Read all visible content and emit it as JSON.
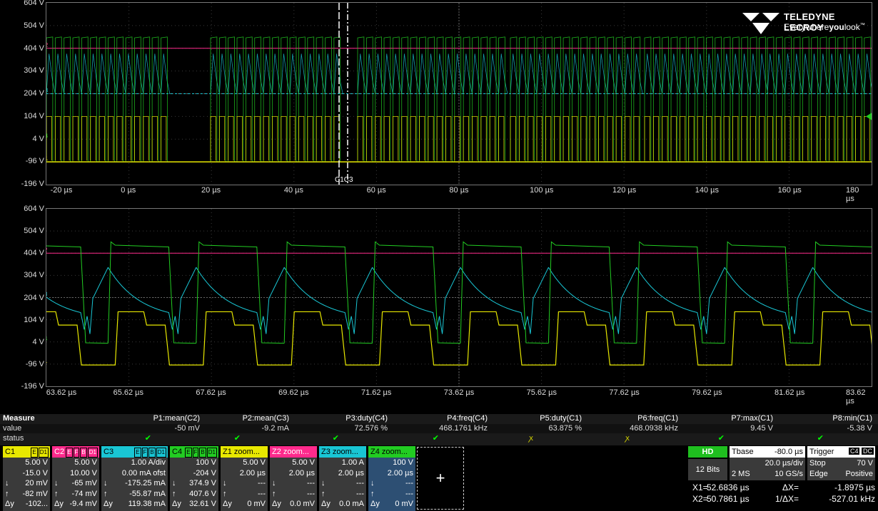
{
  "upper": {
    "y_labels": [
      "604 V",
      "504 V",
      "404 V",
      "304 V",
      "204 V",
      "104 V",
      "4 V",
      "-96 V",
      "-196 V"
    ],
    "x_labels": [
      "-20 µs",
      "0 µs",
      "20 µs",
      "40 µs",
      "60 µs",
      "80 µs",
      "100 µs",
      "120 µs",
      "140 µs",
      "160 µs",
      "180 µs"
    ],
    "cursor_label": "C1C3",
    "channel_tags": [
      "C2",
      "C3",
      "C4",
      "C1"
    ]
  },
  "lower": {
    "y_labels": [
      "604 V",
      "504 V",
      "404 V",
      "304 V",
      "204 V",
      "104 V",
      "4 V",
      "-96 V",
      "-196 V"
    ],
    "x_labels": [
      "63.62 µs",
      "65.62 µs",
      "67.62 µs",
      "69.62 µs",
      "71.62 µs",
      "73.62 µs",
      "75.62 µs",
      "77.62 µs",
      "79.62 µs",
      "81.62 µs",
      "83.62 µs"
    ],
    "channel_tags": [
      "Z2",
      "Z3",
      "Z4",
      "Z1"
    ]
  },
  "logo": {
    "name": "TELEDYNE LECROY",
    "tagline_a": "Everywhere",
    "tagline_b": "you",
    "tagline_c": "look",
    "tm": "™"
  },
  "measure": {
    "title": "Measure",
    "row_value": "value",
    "row_status": "status",
    "params": [
      {
        "name": "P1:mean(C2)",
        "value": "-50 mV",
        "status": "ok"
      },
      {
        "name": "P2:mean(C3)",
        "value": "-9.2 mA",
        "status": "ok"
      },
      {
        "name": "P3:duty(C4)",
        "value": "72.576 %",
        "status": "ok"
      },
      {
        "name": "P4:freq(C4)",
        "value": "468.1761 kHz",
        "status": "ok"
      },
      {
        "name": "P5:duty(C1)",
        "value": "63.875 %",
        "status": "warn"
      },
      {
        "name": "P6:freq(C1)",
        "value": "468.0938 kHz",
        "status": "warn"
      },
      {
        "name": "P7:max(C1)",
        "value": "9.45 V",
        "status": "ok"
      },
      {
        "name": "P8:min(C1)",
        "value": "-5.38 V",
        "status": "ok"
      }
    ],
    "ok_glyph": "✔",
    "warn_glyph": "ꭗ"
  },
  "channels": [
    {
      "name": "C1",
      "badges": [
        "E",
        "D1"
      ],
      "r1": "5.00 V",
      "r2": "-15.0 V",
      "r3a": "↓",
      "r3b": "20 mV",
      "r4a": "↑",
      "r4b": "-82 mV",
      "r5a": "Δy",
      "r5b": "-102..."
    },
    {
      "name": "C2",
      "badges": [
        "E",
        "F",
        "B",
        "D1"
      ],
      "r1": "5.00 V",
      "r2": "10.00 V",
      "r3a": "↓",
      "r3b": "-65 mV",
      "r4a": "↑",
      "r4b": "-74 mV",
      "r5a": "Δy",
      "r5b": "-9.4 mV"
    },
    {
      "name": "C3",
      "badges": [
        "E",
        "F",
        "B",
        "D1"
      ],
      "r1": "1.00 A/div",
      "r2": "0.00 mA ofst",
      "r3a": "↓",
      "r3b": "-175.25 mA",
      "r4a": "↑",
      "r4b": "-55.87 mA",
      "r5a": "Δy",
      "r5b": "119.38 mA"
    },
    {
      "name": "C4",
      "badges": [
        "E",
        "F",
        "B",
        "D1"
      ],
      "r1": "100 V",
      "r2": "-204 V",
      "r3a": "↓",
      "r3b": "374.9 V",
      "r4a": "↑",
      "r4b": "407.6 V",
      "r5a": "Δy",
      "r5b": "32.61 V"
    },
    {
      "name": "Z1 zoom...",
      "badges": [],
      "r1": "5.00 V",
      "r2": "2.00 µs",
      "r3a": "↓",
      "r3b": "---",
      "r4a": "↑",
      "r4b": "---",
      "r5a": "Δy",
      "r5b": "0 mV"
    },
    {
      "name": "Z2 zoom...",
      "badges": [],
      "r1": "5.00 V",
      "r2": "2.00 µs",
      "r3a": "↓",
      "r3b": "---",
      "r4a": "↑",
      "r4b": "---",
      "r5a": "Δy",
      "r5b": "0.0 mV"
    },
    {
      "name": "Z3 zoom...",
      "badges": [],
      "r1": "1.00 A",
      "r2": "2.00 µs",
      "r3a": "↓",
      "r3b": "---",
      "r4a": "↑",
      "r4b": "---",
      "r5a": "Δy",
      "r5b": "0.0 mA"
    },
    {
      "name": "Z4 zoom...",
      "badges": [],
      "r1": "100 V",
      "r2": "2.00 µs",
      "r3a": "↓",
      "r3b": "---",
      "r4a": "↑",
      "r4b": "---",
      "r5a": "Δy",
      "r5b": "0 mV"
    }
  ],
  "add_button": "+",
  "timebase": {
    "hd_label": "HD",
    "bits": "12 Bits",
    "tbase_label": "Tbase",
    "tbase_value": "-80.0 µs",
    "div": "20.0 µs/div",
    "samples": "2 MS",
    "rate": "10 GS/s",
    "trigger_label": "Trigger",
    "trig_badges": [
      "C4",
      "DC"
    ],
    "trig_mode": "Stop",
    "trig_level": "70 V",
    "trig_type": "Edge",
    "trig_slope": "Positive"
  },
  "cursors": {
    "x1_label": "X1=",
    "x1": "52.6836 µs",
    "dx_label": "ΔX=",
    "dx": "-1.8975 µs",
    "x2_label": "X2=",
    "x2": "50.7861 µs",
    "inv_label": "1/ΔX=",
    "inv": "-527.01 kHz"
  },
  "colors": {
    "C1": "#e8e800",
    "C2": "#ff2a8c",
    "C3": "#19c6d4",
    "C4": "#22cc22"
  }
}
